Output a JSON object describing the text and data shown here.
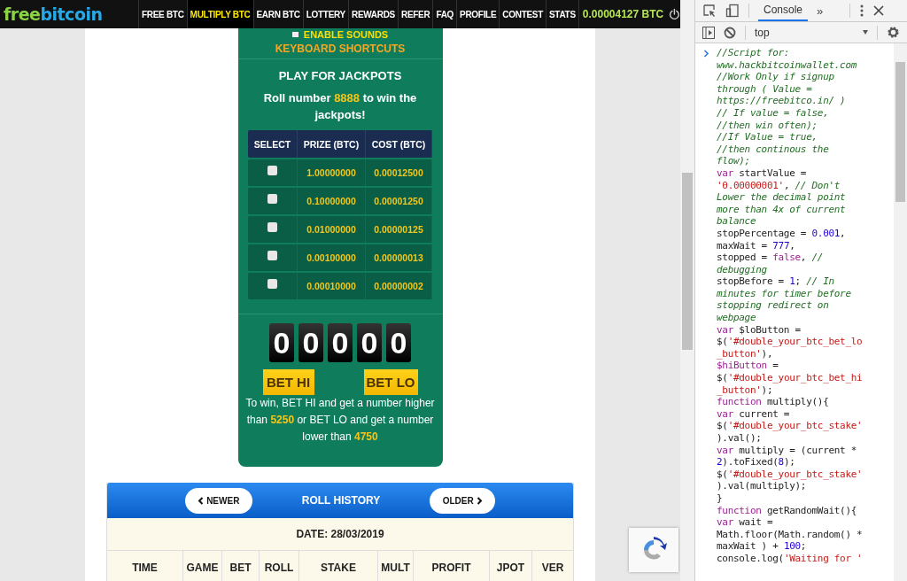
{
  "nav": {
    "logo": [
      {
        "text": "free"
      },
      {
        "text": "bitcoin"
      }
    ],
    "items": [
      {
        "label": "FREE BTC",
        "selected": false
      },
      {
        "label": "MULTIPLY BTC",
        "selected": true
      },
      {
        "label": "EARN BTC",
        "selected": false
      },
      {
        "label": "LOTTERY",
        "selected": false
      },
      {
        "label": "REWARDS",
        "selected": false
      },
      {
        "label": "REFER",
        "selected": false
      },
      {
        "label": "FAQ",
        "selected": false
      },
      {
        "label": "PROFILE",
        "selected": false
      },
      {
        "label": "CONTEST",
        "selected": false
      },
      {
        "label": "STATS",
        "selected": false
      }
    ],
    "balance": "0.00004127 BTC"
  },
  "jackpot_panel": {
    "sounds": {
      "label": "ENABLE SOUNDS",
      "checked": false
    },
    "shortcuts": "KEYBOARD SHORTCUTS",
    "title": "PLAY FOR JACKPOTS",
    "roll_text": [
      {
        "text": "Roll number ",
        "highlight": false
      },
      {
        "text": "8888",
        "highlight": true
      },
      {
        "text": " to win the jackpots!",
        "highlight": false
      }
    ],
    "table": {
      "columns": [
        "SELECT",
        "PRIZE (BTC)",
        "COST (BTC)"
      ],
      "rows": [
        {
          "checked": false,
          "prize": "1.00000000",
          "cost": "0.00012500"
        },
        {
          "checked": false,
          "prize": "0.10000000",
          "cost": "0.00001250"
        },
        {
          "checked": false,
          "prize": "0.01000000",
          "cost": "0.00000125"
        },
        {
          "checked": false,
          "prize": "0.00100000",
          "cost": "0.00000013"
        },
        {
          "checked": false,
          "prize": "0.00010000",
          "cost": "0.00000002"
        }
      ]
    },
    "digits": [
      "0",
      "0",
      "0",
      "0",
      "0"
    ],
    "buttons": [
      "BET HI",
      "BET LO"
    ],
    "rule_text": [
      {
        "text": "To win, BET HI and get a number higher than ",
        "highlight": false
      },
      {
        "text": "5250",
        "highlight": true
      },
      {
        "text": " or BET LO and get a number lower than ",
        "highlight": false
      },
      {
        "text": "4750",
        "highlight": true
      }
    ]
  },
  "roll_history": {
    "title": "ROLL HISTORY",
    "newer": "NEWER",
    "older": "OLDER",
    "date": "DATE: 28/03/2019",
    "columns": [
      "TIME",
      "GAME",
      "BET",
      "ROLL",
      "STAKE",
      "MULT",
      "PROFIT",
      "JPOT",
      "VER"
    ]
  },
  "devtools": {
    "tabs": [
      {
        "label": "Console",
        "selected": true
      }
    ],
    "overflow": "»",
    "context": "top",
    "lines": [
      [
        {
          "t": "//Script for:",
          "kind": "comment"
        }
      ],
      [
        {
          "t": "www.hackbitcoinwallet.com",
          "kind": "comment"
        }
      ],
      [
        {
          "t": "//Work Only if signup",
          "kind": "comment"
        }
      ],
      [
        {
          "t": "through ( Value =",
          "kind": "comment"
        }
      ],
      [
        {
          "t": "https://freebitco.in/ )",
          "kind": "comment"
        }
      ],
      [
        {
          "t": "// If value = false,",
          "kind": "comment"
        }
      ],
      [
        {
          "t": "//then win often);",
          "kind": "comment"
        }
      ],
      [
        {
          "t": "//If Value = true,",
          "kind": "comment"
        }
      ],
      [
        {
          "t": "//then continous the",
          "kind": "comment"
        }
      ],
      [
        {
          "t": "flow);",
          "kind": "comment"
        }
      ],
      [
        {
          "t": "var",
          "kind": "keyword"
        },
        {
          "t": " startValue =",
          "kind": "plain"
        }
      ],
      [
        {
          "t": "'0.00000001'",
          "kind": "string"
        },
        {
          "t": ", ",
          "kind": "plain"
        },
        {
          "t": "// Don't",
          "kind": "comment"
        }
      ],
      [
        {
          "t": "Lower the decimal point",
          "kind": "comment"
        }
      ],
      [
        {
          "t": "more than 4x of current",
          "kind": "comment"
        }
      ],
      [
        {
          "t": "balance",
          "kind": "comment"
        }
      ],
      [
        {
          "t": "stopPercentage = ",
          "kind": "plain"
        },
        {
          "t": "0.001",
          "kind": "number"
        },
        {
          "t": ",",
          "kind": "plain"
        }
      ],
      [
        {
          "t": "maxWait = ",
          "kind": "plain"
        },
        {
          "t": "777",
          "kind": "number"
        },
        {
          "t": ",",
          "kind": "plain"
        }
      ],
      [
        {
          "t": "stopped = ",
          "kind": "plain"
        },
        {
          "t": "false",
          "kind": "keyword"
        },
        {
          "t": ", ",
          "kind": "plain"
        },
        {
          "t": "//",
          "kind": "comment"
        }
      ],
      [
        {
          "t": "debugging",
          "kind": "comment"
        }
      ],
      [
        {
          "t": "stopBefore = ",
          "kind": "plain"
        },
        {
          "t": "1",
          "kind": "number"
        },
        {
          "t": "; ",
          "kind": "plain"
        },
        {
          "t": "// In",
          "kind": "comment"
        }
      ],
      [
        {
          "t": "minutes for timer before",
          "kind": "comment"
        }
      ],
      [
        {
          "t": "stopping redirect on",
          "kind": "comment"
        }
      ],
      [
        {
          "t": "webpage",
          "kind": "comment"
        }
      ],
      [
        {
          "t": "var",
          "kind": "keyword"
        },
        {
          "t": " $loButton =",
          "kind": "plain"
        }
      ],
      [
        {
          "t": "$(",
          "kind": "plain"
        },
        {
          "t": "'#double_your_btc_bet_lo",
          "kind": "string"
        }
      ],
      [
        {
          "t": "_button'",
          "kind": "string"
        },
        {
          "t": "),",
          "kind": "plain"
        }
      ],
      [
        {
          "t": "$hiButton",
          "kind": "keyword"
        },
        {
          "t": " =",
          "kind": "plain"
        }
      ],
      [
        {
          "t": "$(",
          "kind": "plain"
        },
        {
          "t": "'#double_your_btc_bet_hi",
          "kind": "string"
        }
      ],
      [
        {
          "t": "_button'",
          "kind": "string"
        },
        {
          "t": ");",
          "kind": "plain"
        }
      ],
      [
        {
          "t": "function",
          "kind": "keyword"
        },
        {
          "t": " multiply(){",
          "kind": "plain"
        }
      ],
      [
        {
          "t": "var",
          "kind": "keyword"
        },
        {
          "t": " current =",
          "kind": "plain"
        }
      ],
      [
        {
          "t": "$(",
          "kind": "plain"
        },
        {
          "t": "'#double_your_btc_stake'",
          "kind": "string"
        }
      ],
      [
        {
          "t": ").val();",
          "kind": "plain"
        }
      ],
      [
        {
          "t": "var",
          "kind": "keyword"
        },
        {
          "t": " multiply = (current * ",
          "kind": "plain"
        }
      ],
      [
        {
          "t": "2",
          "kind": "number"
        },
        {
          "t": ").toFixed(",
          "kind": "plain"
        },
        {
          "t": "8",
          "kind": "number"
        },
        {
          "t": ");",
          "kind": "plain"
        }
      ],
      [
        {
          "t": "$(",
          "kind": "plain"
        },
        {
          "t": "'#double_your_btc_stake'",
          "kind": "string"
        }
      ],
      [
        {
          "t": ").val(multiply);",
          "kind": "plain"
        }
      ],
      [
        {
          "t": "}",
          "kind": "plain"
        }
      ],
      [
        {
          "t": "function",
          "kind": "keyword"
        },
        {
          "t": " getRandomWait(){",
          "kind": "plain"
        }
      ],
      [
        {
          "t": "var",
          "kind": "keyword"
        },
        {
          "t": " wait =",
          "kind": "plain"
        }
      ],
      [
        {
          "t": "Math.floor(Math.random() * ",
          "kind": "plain"
        }
      ],
      [
        {
          "t": "maxWait ) + ",
          "kind": "plain"
        },
        {
          "t": "100",
          "kind": "number"
        },
        {
          "t": ";",
          "kind": "plain"
        }
      ],
      [
        {
          "t": "console.log(",
          "kind": "plain"
        },
        {
          "t": "'Waiting for '",
          "kind": "string"
        }
      ]
    ]
  }
}
